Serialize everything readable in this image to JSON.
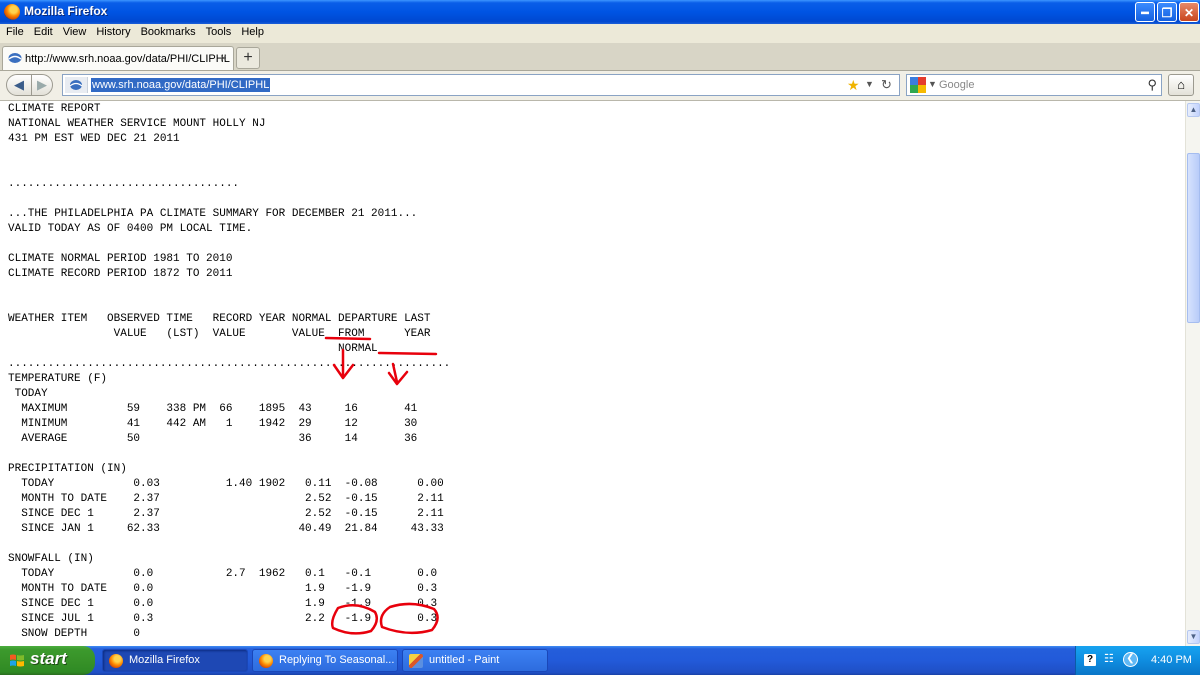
{
  "window": {
    "title": "Mozilla Firefox",
    "controls": [
      "minimize-icon",
      "maximize-icon",
      "close-icon"
    ]
  },
  "menu": [
    "File",
    "Edit",
    "View",
    "History",
    "Bookmarks",
    "Tools",
    "Help"
  ],
  "tab": {
    "title": "http://www.srh.noaa.gov/data/PHI/CLIPHL",
    "close": "×",
    "new_tab": "+"
  },
  "nav": {
    "url": "www.srh.noaa.gov/data/PHI/CLIPHL",
    "search_placeholder": "Google"
  },
  "report": {
    "lines": [
      "CLIMATE REPORT",
      "NATIONAL WEATHER SERVICE MOUNT HOLLY NJ",
      "431 PM EST WED DEC 21 2011",
      "",
      "",
      "...................................",
      "",
      "...THE PHILADELPHIA PA CLIMATE SUMMARY FOR DECEMBER 21 2011...",
      "VALID TODAY AS OF 0400 PM LOCAL TIME.",
      "",
      "CLIMATE NORMAL PERIOD 1981 TO 2010",
      "CLIMATE RECORD PERIOD 1872 TO 2011",
      "",
      "",
      "WEATHER ITEM   OBSERVED TIME   RECORD YEAR NORMAL DEPARTURE LAST",
      "                VALUE   (LST)  VALUE       VALUE  FROM      YEAR",
      "                                                  NORMAL",
      "...................................................................",
      "TEMPERATURE (F)",
      " TODAY",
      "  MAXIMUM         59    338 PM  66    1895  43     16       41",
      "  MINIMUM         41    442 AM   1    1942  29     12       30",
      "  AVERAGE         50                        36     14       36",
      "",
      "PRECIPITATION (IN)",
      "  TODAY            0.03          1.40 1902   0.11  -0.08      0.00",
      "  MONTH TO DATE    2.37                      2.52  -0.15      2.11",
      "  SINCE DEC 1      2.37                      2.52  -0.15      2.11",
      "  SINCE JAN 1     62.33                     40.49  21.84     43.33",
      "",
      "SNOWFALL (IN)",
      "  TODAY            0.0           2.7  1962   0.1   -0.1       0.0",
      "  MONTH TO DATE    0.0                       1.9   -1.9       0.3",
      "  SINCE DEC 1      0.0                       1.9   -1.9       0.3",
      "  SINCE JUL 1      0.3                       2.2   -1.9       0.3",
      "  SNOW DEPTH       0"
    ]
  },
  "annotation_color": "#e8000c",
  "taskbar": {
    "start": "start",
    "items": [
      {
        "label": "Mozilla Firefox",
        "icon": "firefox-icon",
        "active": true
      },
      {
        "label": "Replying To Seasonal...",
        "icon": "firefox-icon",
        "active": false
      },
      {
        "label": "untitled - Paint",
        "icon": "paint-icon",
        "active": false
      }
    ],
    "tray_help": "?",
    "clock": "4:40 PM"
  }
}
